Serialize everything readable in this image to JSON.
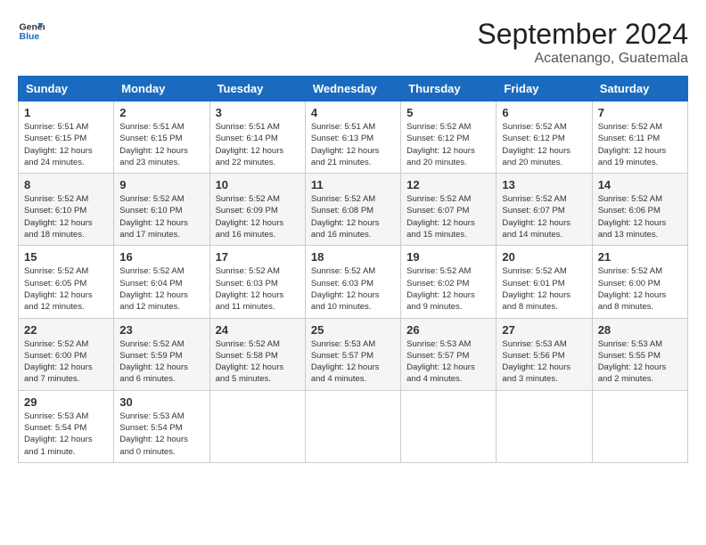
{
  "header": {
    "logo_line1": "General",
    "logo_line2": "Blue",
    "month_year": "September 2024",
    "location": "Acatenango, Guatemala"
  },
  "columns": [
    "Sunday",
    "Monday",
    "Tuesday",
    "Wednesday",
    "Thursday",
    "Friday",
    "Saturday"
  ],
  "weeks": [
    [
      {
        "day": "1",
        "sunrise": "Sunrise: 5:51 AM",
        "sunset": "Sunset: 6:15 PM",
        "daylight": "Daylight: 12 hours and 24 minutes."
      },
      {
        "day": "2",
        "sunrise": "Sunrise: 5:51 AM",
        "sunset": "Sunset: 6:15 PM",
        "daylight": "Daylight: 12 hours and 23 minutes."
      },
      {
        "day": "3",
        "sunrise": "Sunrise: 5:51 AM",
        "sunset": "Sunset: 6:14 PM",
        "daylight": "Daylight: 12 hours and 22 minutes."
      },
      {
        "day": "4",
        "sunrise": "Sunrise: 5:51 AM",
        "sunset": "Sunset: 6:13 PM",
        "daylight": "Daylight: 12 hours and 21 minutes."
      },
      {
        "day": "5",
        "sunrise": "Sunrise: 5:52 AM",
        "sunset": "Sunset: 6:12 PM",
        "daylight": "Daylight: 12 hours and 20 minutes."
      },
      {
        "day": "6",
        "sunrise": "Sunrise: 5:52 AM",
        "sunset": "Sunset: 6:12 PM",
        "daylight": "Daylight: 12 hours and 20 minutes."
      },
      {
        "day": "7",
        "sunrise": "Sunrise: 5:52 AM",
        "sunset": "Sunset: 6:11 PM",
        "daylight": "Daylight: 12 hours and 19 minutes."
      }
    ],
    [
      {
        "day": "8",
        "sunrise": "Sunrise: 5:52 AM",
        "sunset": "Sunset: 6:10 PM",
        "daylight": "Daylight: 12 hours and 18 minutes."
      },
      {
        "day": "9",
        "sunrise": "Sunrise: 5:52 AM",
        "sunset": "Sunset: 6:10 PM",
        "daylight": "Daylight: 12 hours and 17 minutes."
      },
      {
        "day": "10",
        "sunrise": "Sunrise: 5:52 AM",
        "sunset": "Sunset: 6:09 PM",
        "daylight": "Daylight: 12 hours and 16 minutes."
      },
      {
        "day": "11",
        "sunrise": "Sunrise: 5:52 AM",
        "sunset": "Sunset: 6:08 PM",
        "daylight": "Daylight: 12 hours and 16 minutes."
      },
      {
        "day": "12",
        "sunrise": "Sunrise: 5:52 AM",
        "sunset": "Sunset: 6:07 PM",
        "daylight": "Daylight: 12 hours and 15 minutes."
      },
      {
        "day": "13",
        "sunrise": "Sunrise: 5:52 AM",
        "sunset": "Sunset: 6:07 PM",
        "daylight": "Daylight: 12 hours and 14 minutes."
      },
      {
        "day": "14",
        "sunrise": "Sunrise: 5:52 AM",
        "sunset": "Sunset: 6:06 PM",
        "daylight": "Daylight: 12 hours and 13 minutes."
      }
    ],
    [
      {
        "day": "15",
        "sunrise": "Sunrise: 5:52 AM",
        "sunset": "Sunset: 6:05 PM",
        "daylight": "Daylight: 12 hours and 12 minutes."
      },
      {
        "day": "16",
        "sunrise": "Sunrise: 5:52 AM",
        "sunset": "Sunset: 6:04 PM",
        "daylight": "Daylight: 12 hours and 12 minutes."
      },
      {
        "day": "17",
        "sunrise": "Sunrise: 5:52 AM",
        "sunset": "Sunset: 6:03 PM",
        "daylight": "Daylight: 12 hours and 11 minutes."
      },
      {
        "day": "18",
        "sunrise": "Sunrise: 5:52 AM",
        "sunset": "Sunset: 6:03 PM",
        "daylight": "Daylight: 12 hours and 10 minutes."
      },
      {
        "day": "19",
        "sunrise": "Sunrise: 5:52 AM",
        "sunset": "Sunset: 6:02 PM",
        "daylight": "Daylight: 12 hours and 9 minutes."
      },
      {
        "day": "20",
        "sunrise": "Sunrise: 5:52 AM",
        "sunset": "Sunset: 6:01 PM",
        "daylight": "Daylight: 12 hours and 8 minutes."
      },
      {
        "day": "21",
        "sunrise": "Sunrise: 5:52 AM",
        "sunset": "Sunset: 6:00 PM",
        "daylight": "Daylight: 12 hours and 8 minutes."
      }
    ],
    [
      {
        "day": "22",
        "sunrise": "Sunrise: 5:52 AM",
        "sunset": "Sunset: 6:00 PM",
        "daylight": "Daylight: 12 hours and 7 minutes."
      },
      {
        "day": "23",
        "sunrise": "Sunrise: 5:52 AM",
        "sunset": "Sunset: 5:59 PM",
        "daylight": "Daylight: 12 hours and 6 minutes."
      },
      {
        "day": "24",
        "sunrise": "Sunrise: 5:52 AM",
        "sunset": "Sunset: 5:58 PM",
        "daylight": "Daylight: 12 hours and 5 minutes."
      },
      {
        "day": "25",
        "sunrise": "Sunrise: 5:53 AM",
        "sunset": "Sunset: 5:57 PM",
        "daylight": "Daylight: 12 hours and 4 minutes."
      },
      {
        "day": "26",
        "sunrise": "Sunrise: 5:53 AM",
        "sunset": "Sunset: 5:57 PM",
        "daylight": "Daylight: 12 hours and 4 minutes."
      },
      {
        "day": "27",
        "sunrise": "Sunrise: 5:53 AM",
        "sunset": "Sunset: 5:56 PM",
        "daylight": "Daylight: 12 hours and 3 minutes."
      },
      {
        "day": "28",
        "sunrise": "Sunrise: 5:53 AM",
        "sunset": "Sunset: 5:55 PM",
        "daylight": "Daylight: 12 hours and 2 minutes."
      }
    ],
    [
      {
        "day": "29",
        "sunrise": "Sunrise: 5:53 AM",
        "sunset": "Sunset: 5:54 PM",
        "daylight": "Daylight: 12 hours and 1 minute."
      },
      {
        "day": "30",
        "sunrise": "Sunrise: 5:53 AM",
        "sunset": "Sunset: 5:54 PM",
        "daylight": "Daylight: 12 hours and 0 minutes."
      },
      null,
      null,
      null,
      null,
      null
    ]
  ]
}
